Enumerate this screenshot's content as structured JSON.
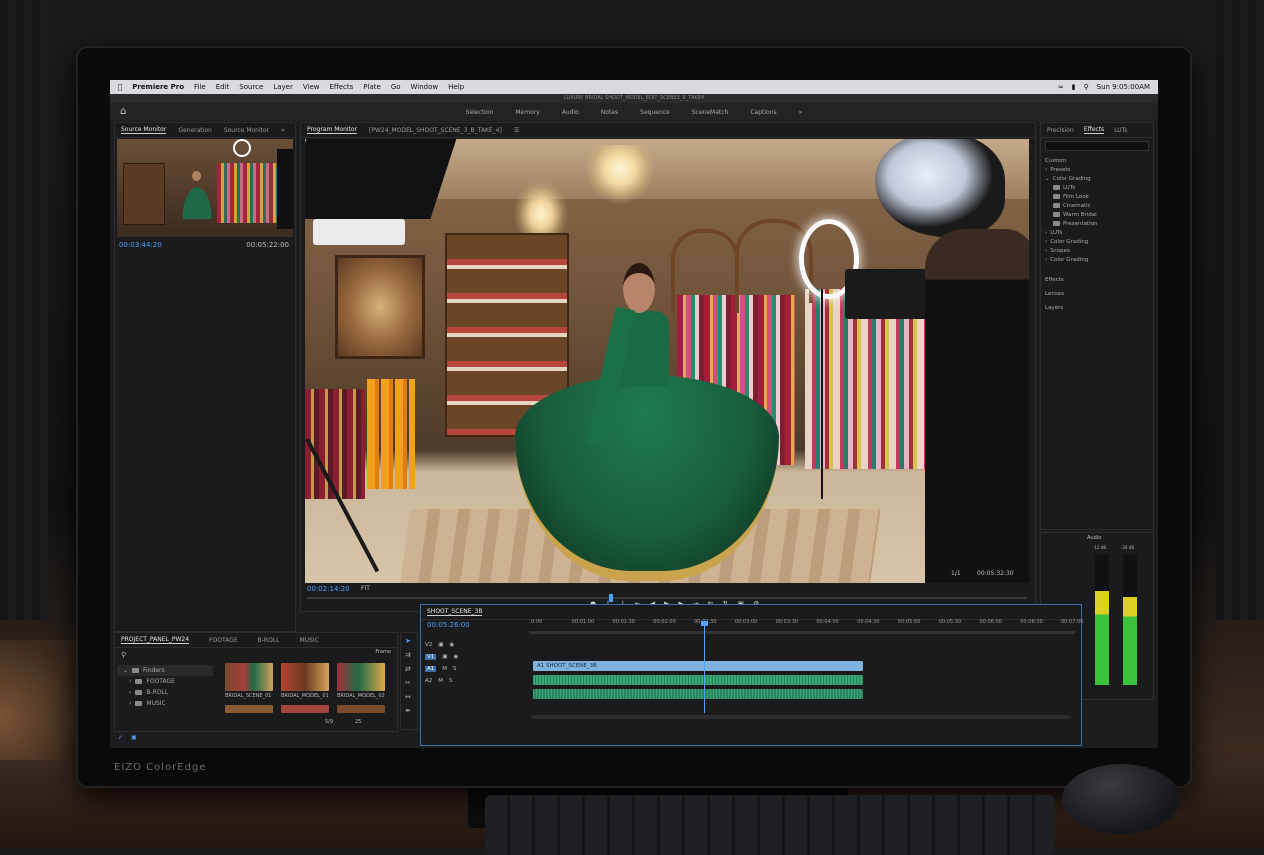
{
  "app": {
    "menu": [
      "Premiere Pro",
      "File",
      "Edit",
      "Source",
      "Layer",
      "View",
      "Effects",
      "Plate",
      "Go",
      "Window",
      "Help"
    ],
    "clock": "Sun 9:05:00AM",
    "window_title": "LUXURY BRIDAL SHOOT_MODEL_EDIT_SCENE3_B_TAKE4"
  },
  "workspaces": [
    "Selection",
    "Memory",
    "Audio",
    "Notes",
    "Sequence",
    "SceneMatch",
    "Captions"
  ],
  "source_monitor": {
    "tabs": [
      "Source Monitor",
      "Generation",
      "Source Monitor"
    ],
    "timecode": "00:03:44:20",
    "duration": "00:05:22:00"
  },
  "program_monitor": {
    "tab": "Program Monitor",
    "sequence": "[PW24_MODEL_SHOOT_SCENE_3_B_TAKE_4]",
    "timecode": "00:02:14:20",
    "fit": "FIT",
    "duration": "00:05:32:30",
    "quality": "1/1"
  },
  "effects_panel": {
    "tabs": [
      "Precision",
      "Effects",
      "LUTs"
    ],
    "header": "Custom",
    "tree": [
      "Presets",
      "Color Grading",
      "LUTs",
      "Film Look",
      "Cinematic",
      "Warm Bridal",
      "Presentation",
      "LUTs",
      "Color Grading",
      "Scopes",
      "Color Grading"
    ],
    "sections": [
      "Effects",
      "Lenses",
      "Layers"
    ]
  },
  "audio_meter": {
    "labels": [
      "Audio",
      "-12 dB",
      "-24 dB"
    ],
    "left_level": 0.72,
    "right_level": 0.68
  },
  "project_panel": {
    "tabs": [
      "PROJECT_PANEL_PW24",
      "FOOTAGE",
      "B-ROLL",
      "MUSIC"
    ],
    "frame_label": "Frame",
    "folders": [
      "Finders",
      "FOOTAGE",
      "B-ROLL",
      "MUSIC"
    ],
    "thumbs": [
      "BRIDAL_SCENE_01",
      "BRIDAL_MODEL_01",
      "BRIDAL_MODEL_02"
    ],
    "counts": [
      "5/9",
      "25"
    ]
  },
  "timeline": {
    "sequence_name": "SHOOT_SCENE_3B",
    "timecode": "00:05:26:00",
    "ruler": [
      "0:00",
      "00:01:00",
      "00:01:30",
      "00:02:00",
      "00:02:30",
      "00:03:00",
      "00:03:30",
      "00:04:00",
      "00:04:30",
      "00:05:00",
      "00:05:30",
      "00:06:00",
      "00:06:30",
      "00:07:00"
    ],
    "tracks": [
      "V2",
      "V1",
      "A1",
      "A2"
    ],
    "video_clip": "A1  SHOOT_SCENE_3B",
    "playhead_fraction": 0.31
  },
  "colors": {
    "accent": "#4da3ff",
    "video_clip": "#7fb2dc",
    "audio_clip": "#39a67a",
    "meter_green": "#39c23a",
    "meter_yellow": "#d9d223"
  },
  "monitor_brand": "EIZO ColorEdge"
}
